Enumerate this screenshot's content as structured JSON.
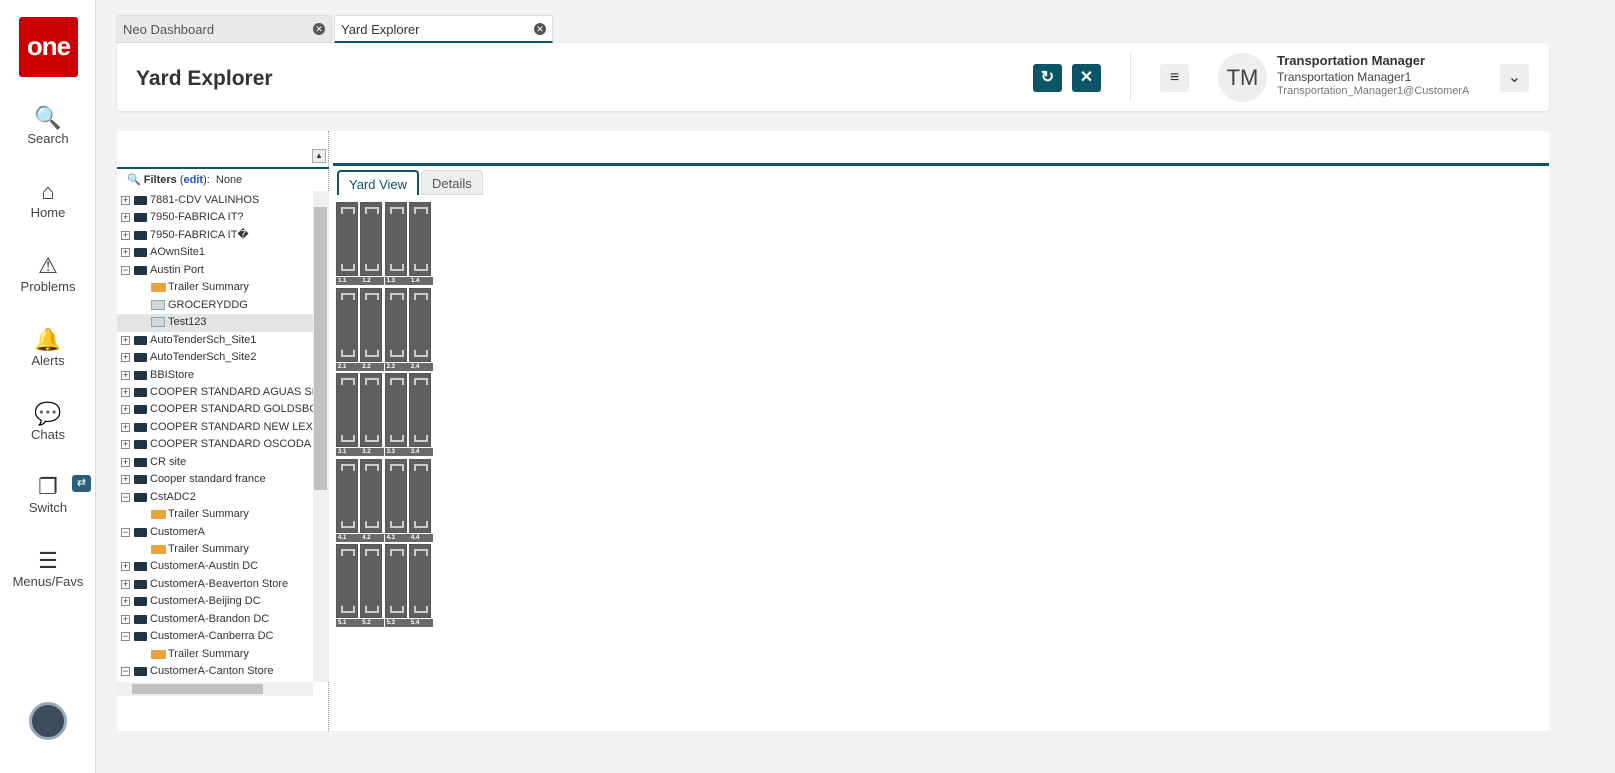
{
  "sidebar": {
    "logo": "one",
    "items": [
      {
        "label": "Search",
        "icon": "search-icon"
      },
      {
        "label": "Home",
        "icon": "home-icon"
      },
      {
        "label": "Problems",
        "icon": "warning-icon"
      },
      {
        "label": "Alerts",
        "icon": "bell-icon"
      },
      {
        "label": "Chats",
        "icon": "chat-icon"
      },
      {
        "label": "Switch",
        "icon": "switch-icon"
      },
      {
        "label": "Menus/Favs",
        "icon": "menu-icon"
      }
    ]
  },
  "tabs": [
    {
      "label": "Neo Dashboard"
    },
    {
      "label": "Yard Explorer"
    }
  ],
  "header": {
    "title": "Yard Explorer",
    "user": {
      "initials": "TM",
      "name": "Transportation Manager",
      "role": "Transportation Manager1",
      "email": "Transportation_Manager1@CustomerA"
    }
  },
  "filters": {
    "label": "Filters",
    "edit": "edit",
    "value": "None"
  },
  "tree": [
    {
      "label": "7881-CDV VALINHOS",
      "type": "folder",
      "level": 0
    },
    {
      "label": "7950-FABRICA IT?",
      "type": "folder",
      "level": 0
    },
    {
      "label": "7950-FABRICA IT�",
      "type": "folder",
      "level": 0
    },
    {
      "label": "AOwnSite1",
      "type": "folder",
      "level": 0
    },
    {
      "label": "Austin Port",
      "type": "open",
      "level": 0
    },
    {
      "label": "Trailer Summary",
      "type": "trailer",
      "level": 1
    },
    {
      "label": "GROCERYDDG",
      "type": "grid",
      "level": 1
    },
    {
      "label": "Test123",
      "type": "grid",
      "level": 1,
      "selected": true
    },
    {
      "label": "AutoTenderSch_Site1",
      "type": "folder",
      "level": 0
    },
    {
      "label": "AutoTenderSch_Site2",
      "type": "folder",
      "level": 0
    },
    {
      "label": "BBIStore",
      "type": "folder",
      "level": 0
    },
    {
      "label": "COOPER STANDARD AGUAS SEAL",
      "type": "folder",
      "level": 0
    },
    {
      "label": "COOPER STANDARD GOLDSBORO",
      "type": "folder",
      "level": 0
    },
    {
      "label": "COOPER STANDARD NEW LEXING",
      "type": "folder",
      "level": 0
    },
    {
      "label": "COOPER STANDARD OSCODA",
      "type": "folder",
      "level": 0
    },
    {
      "label": "CR site",
      "type": "folder",
      "level": 0
    },
    {
      "label": "Cooper standard france",
      "type": "folder",
      "level": 0
    },
    {
      "label": "CstADC2",
      "type": "open",
      "level": 0
    },
    {
      "label": "Trailer Summary",
      "type": "trailer",
      "level": 1
    },
    {
      "label": "CustomerA",
      "type": "open",
      "level": 0
    },
    {
      "label": "Trailer Summary",
      "type": "trailer",
      "level": 1
    },
    {
      "label": "CustomerA-Austin DC",
      "type": "folder",
      "level": 0
    },
    {
      "label": "CustomerA-Beaverton Store",
      "type": "folder",
      "level": 0
    },
    {
      "label": "CustomerA-Beijing DC",
      "type": "folder",
      "level": 0
    },
    {
      "label": "CustomerA-Brandon DC",
      "type": "folder",
      "level": 0
    },
    {
      "label": "CustomerA-Canberra DC",
      "type": "open",
      "level": 0
    },
    {
      "label": "Trailer Summary",
      "type": "trailer",
      "level": 1
    },
    {
      "label": "CustomerA-Canton Store",
      "type": "open",
      "level": 0
    }
  ],
  "yard": {
    "tabs": [
      {
        "label": "Yard View",
        "active": true
      },
      {
        "label": "Details"
      }
    ],
    "slots": [
      [
        "1.1",
        "1.2",
        "1.3",
        "1.4"
      ],
      [
        "2.1",
        "2.2",
        "2.3",
        "2.4"
      ],
      [
        "3.1",
        "3.2",
        "3.3",
        "3.4"
      ],
      [
        "4.1",
        "4.2",
        "4.3",
        "4.4"
      ],
      [
        "5.1",
        "5.2",
        "5.3",
        "5.4"
      ]
    ]
  }
}
